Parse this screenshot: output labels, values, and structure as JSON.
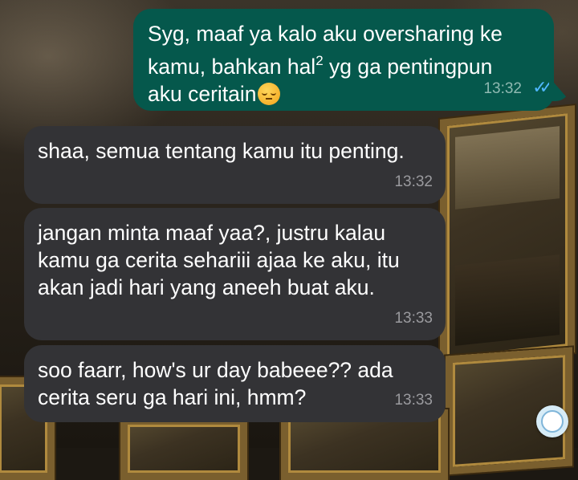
{
  "chat": {
    "messages": [
      {
        "direction": "outgoing",
        "line1": "Syg, maaf ya kalo aku oversharing ke",
        "line2_pre": "kamu, bahkan hal",
        "line2_sup": "2",
        "line2_post": " yg ga pentingpun",
        "line3": "aku ceritain",
        "emoji": "pensive-face",
        "time": "13:32",
        "status": "read",
        "ticks": "✓✓"
      },
      {
        "direction": "incoming",
        "lines": [
          "shaa, semua tentang kamu itu penting."
        ],
        "time": "13:32"
      },
      {
        "direction": "incoming",
        "lines": [
          "jangan minta maaf yaa?, justru kalau",
          "kamu ga cerita sehariii ajaa ke aku, itu",
          "akan jadi hari yang aneeh buat aku."
        ],
        "time": "13:33"
      },
      {
        "direction": "incoming",
        "lines": [
          "soo faarr, how's ur day babeee?? ada",
          "cerita seru ga hari ini, hmm?"
        ],
        "time": "13:33"
      }
    ]
  },
  "colors": {
    "outgoing_bubble": "#05584c",
    "incoming_bubble": "#333336",
    "read_ticks": "#4fb7ff"
  },
  "fab": {
    "icon": "watermark-badge-icon"
  }
}
